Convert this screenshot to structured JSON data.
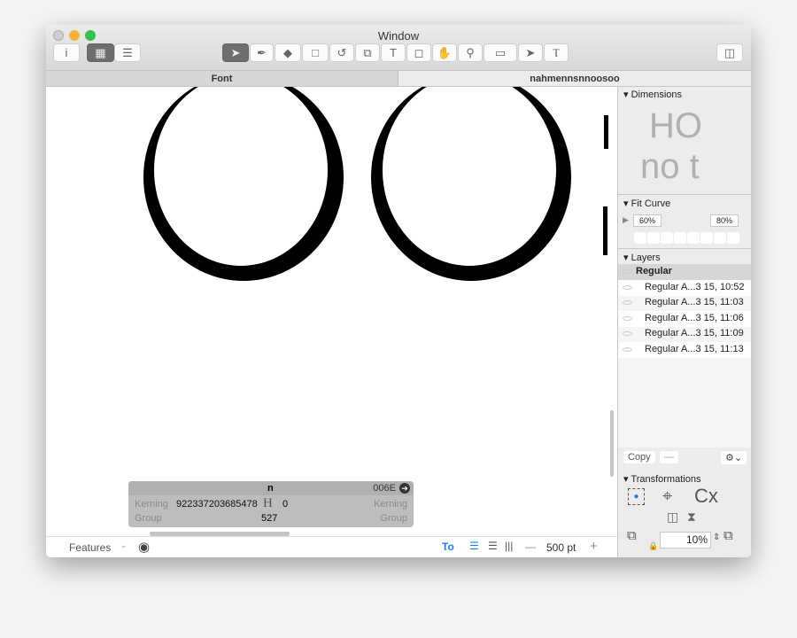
{
  "window": {
    "title": "Window"
  },
  "toolbar": {
    "info": "i",
    "tools": [
      "select-tool",
      "pen-tool",
      "eraser-tool",
      "rectangle-tool",
      "rotate-tool",
      "scale-tool",
      "text-tool",
      "annotation-tool",
      "hand-tool",
      "zoom-tool",
      "measure-tool",
      "select-all-layers-tool",
      "hint-tool"
    ]
  },
  "tabs": [
    {
      "label": "Font"
    },
    {
      "label": "nahmennsnnoosoo"
    }
  ],
  "glyph_info": {
    "name": "n",
    "unicode": "006E",
    "left_label": "Kerning",
    "left_group": "Group",
    "right_label": "Kerning",
    "right_group": "Group",
    "left_kerning": "922337203685478",
    "right_kerning": "0",
    "width": "527"
  },
  "bottom": {
    "features": "Features",
    "size": "500 pt",
    "minus": "—",
    "plus": "+"
  },
  "sidebar": {
    "dimensions": {
      "title": "Dimensions",
      "preview_top": "HO",
      "preview_bottom": "no t"
    },
    "fit_curve": {
      "title": "Fit Curve",
      "min": "60%",
      "max": "80%"
    },
    "layers": {
      "title": "Layers",
      "master": "Regular",
      "items": [
        "Regular A...3 15, 10:52",
        "Regular A...3 15, 11:03",
        "Regular A...3 15, 11:06",
        "Regular A...3 15, 11:09",
        "Regular A...3 15, 11:13"
      ],
      "copy": "Copy",
      "minus": "—"
    },
    "transformations": {
      "title": "Transformations",
      "scale": "10%",
      "cx": "Cx"
    }
  },
  "colors": {
    "accent": "#1a7cf5",
    "close": "#c8c8c8",
    "minimize": "#f5b33c",
    "zoom": "#35c14b"
  }
}
